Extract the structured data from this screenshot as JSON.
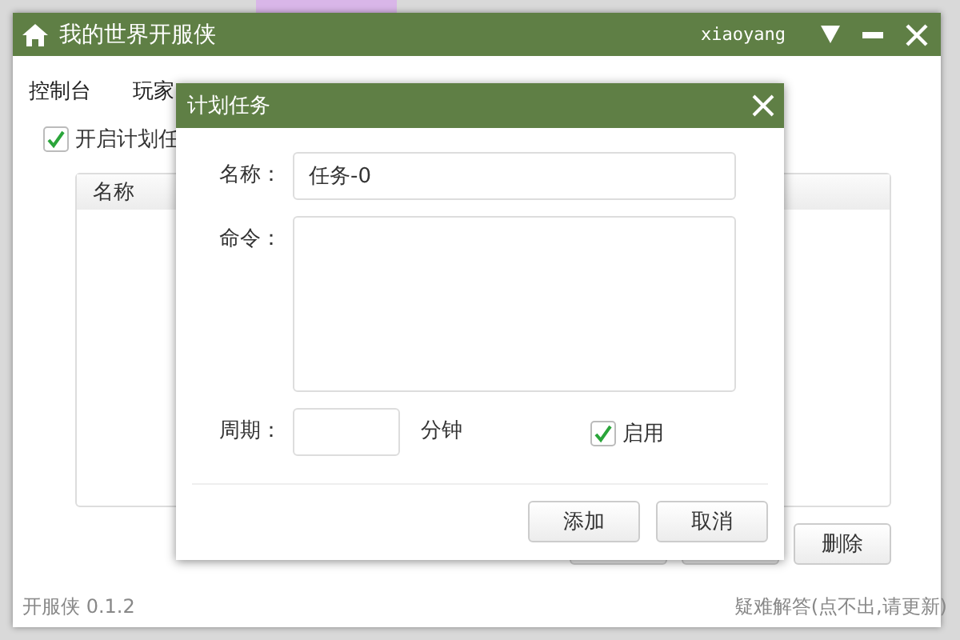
{
  "window": {
    "title": "我的世界开服侠",
    "user": "xiaoyang"
  },
  "tabs": [
    "控制台",
    "玩家"
  ],
  "schedule_toggle": {
    "label": "开启计划任",
    "checked": true
  },
  "table": {
    "columns": [
      "名称"
    ]
  },
  "buttons": [
    "删除"
  ],
  "footer": {
    "version": "开服侠 0.1.2",
    "help_link": "疑难解答(点不出,请更新)"
  },
  "dialog": {
    "title": "计划任务",
    "name": {
      "label": "名称：",
      "value": "任务-0"
    },
    "command": {
      "label": "命令："
    },
    "period": {
      "label": "周期：",
      "unit": "分钟"
    },
    "enabled": {
      "label": "启用",
      "checked": true
    },
    "buttons": [
      "添加",
      "取消"
    ]
  }
}
